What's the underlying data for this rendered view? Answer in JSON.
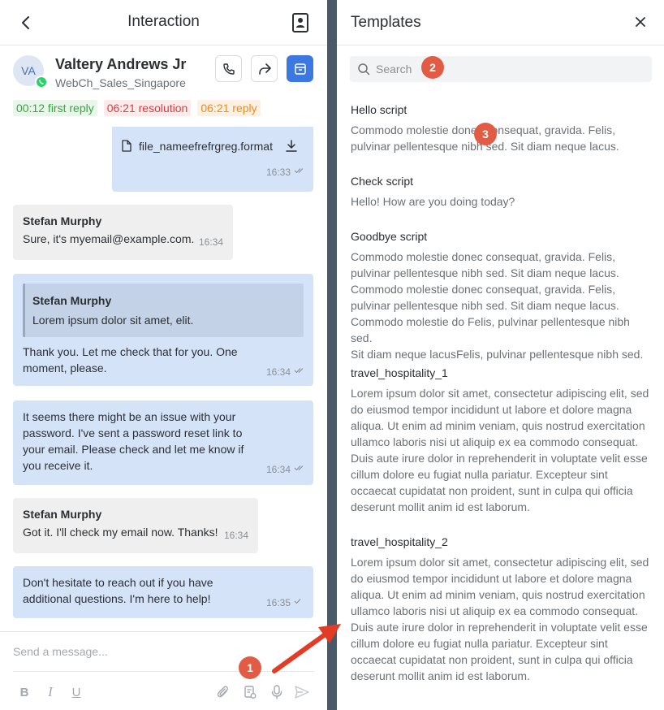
{
  "left_panel": {
    "header": {
      "title": "Interaction"
    },
    "contact": {
      "initials": "VA",
      "name": "Valtery Andrews Jr",
      "channel": "WebCh_Sales_Singapore"
    },
    "sla_tags": [
      {
        "label": "00:12 first reply",
        "color": "#37a53e"
      },
      {
        "label": "06:21 resolution",
        "color": "#e03b3b"
      },
      {
        "label": "06:21 reply",
        "color": "#ef8a1f"
      }
    ],
    "messages": {
      "file": {
        "filename": "file_nameefrefrgreg.format",
        "time": "16:33"
      },
      "m1": {
        "author": "Stefan Murphy",
        "text": "Sure, it's myemail@example.com.",
        "time": "16:34"
      },
      "m2": {
        "quote_author": "Stefan Murphy",
        "quote_text": "Lorem ipsum dolor sit amet, elit.",
        "line1": "Thank you. Let me check that for you. One",
        "line2": "moment, please.",
        "time": "16:34"
      },
      "m3": {
        "line1": "It seems there might be an issue with your",
        "line2": "password. I've sent a password reset link to",
        "line3": "your email. Please check and let me know if",
        "line4": "you receive it.",
        "time": "16:34"
      },
      "m4": {
        "author": "Stefan Murphy",
        "text": "Got it. I'll check my email now. Thanks!",
        "time": "16:34"
      },
      "m5": {
        "line1": "Don't hesitate to reach out if you have",
        "line2": "additional questions. I'm here to help!",
        "time": "16:35"
      }
    },
    "composer": {
      "placeholder": "Send a message...",
      "tools": {
        "bold": "B",
        "italic": "I",
        "underline": "U"
      }
    }
  },
  "right_panel": {
    "header": {
      "title": "Templates"
    },
    "search": {
      "placeholder": "Search",
      "value": ""
    },
    "templates": [
      {
        "name": "Hello script",
        "lines": [
          "Commodo molestie donec consequat, gravida. Felis,",
          "pulvinar pellentesque nibh sed. Sit diam neque lacus."
        ]
      },
      {
        "name": "Check script",
        "lines": [
          "Hello! How are you doing today?"
        ]
      },
      {
        "name": "Goodbye script",
        "lines": [
          "Commodo molestie donec consequat, gravida. Felis,",
          "pulvinar pellentesque nibh sed. Sit diam neque lacus.",
          "Commodo molestie donec consequat, gravida. Felis,",
          "pulvinar pellentesque nibh sed. Sit diam neque lacus.",
          "Commodo molestie do Felis, pulvinar pellentesque nibh sed.",
          "Sit diam neque lacusFelis, pulvinar pellentesque nibh sed."
        ]
      },
      {
        "name": "travel_hospitality_1",
        "lines": [
          "Lorem ipsum dolor sit amet, consectetur adipiscing elit, sed",
          "do eiusmod tempor incididunt ut labore et dolore magna",
          "aliqua. Ut enim ad minim veniam, quis nostrud exercitation",
          "ullamco laboris nisi ut aliquip ex ea commodo consequat.",
          "Duis aute irure dolor in reprehenderit in voluptate velit esse",
          "cillum dolore eu fugiat nulla pariatur. Excepteur sint",
          "occaecat cupidatat non proident, sunt in culpa qui officia",
          "deserunt mollit anim id est laborum."
        ]
      },
      {
        "name": "travel_hospitality_2",
        "lines": [
          "Lorem ipsum dolor sit amet, consectetur adipiscing elit, sed",
          "do eiusmod tempor incididunt ut labore et dolore magna",
          "aliqua. Ut enim ad minim veniam, quis nostrud exercitation",
          "ullamco laboris nisi ut aliquip ex ea commodo consequat.",
          "Duis aute irure dolor in reprehenderit in voluptate velit esse",
          "cillum dolore eu fugiat nulla pariatur. Excepteur sint",
          "occaecat cupidatat non proident, sunt in culpa qui officia",
          "deserunt mollit anim id est laborum."
        ]
      }
    ]
  },
  "annotations": {
    "marker_1": "1",
    "marker_2": "2",
    "marker_3": "3"
  },
  "colors": {
    "accent": "#3b78e0",
    "outgoing_bubble": "#d5e3f8",
    "incoming_bubble": "#efefef",
    "divider": "#4a5968",
    "annotation": "#e25c45"
  },
  "icons": [
    "back-arrow-icon",
    "contact-card-icon",
    "whatsapp-icon",
    "phone-icon",
    "forward-icon",
    "archive-icon",
    "file-icon",
    "download-icon",
    "double-check-icon",
    "check-icon",
    "attach-icon",
    "template-icon",
    "mic-icon",
    "send-icon",
    "search-icon",
    "close-icon"
  ]
}
